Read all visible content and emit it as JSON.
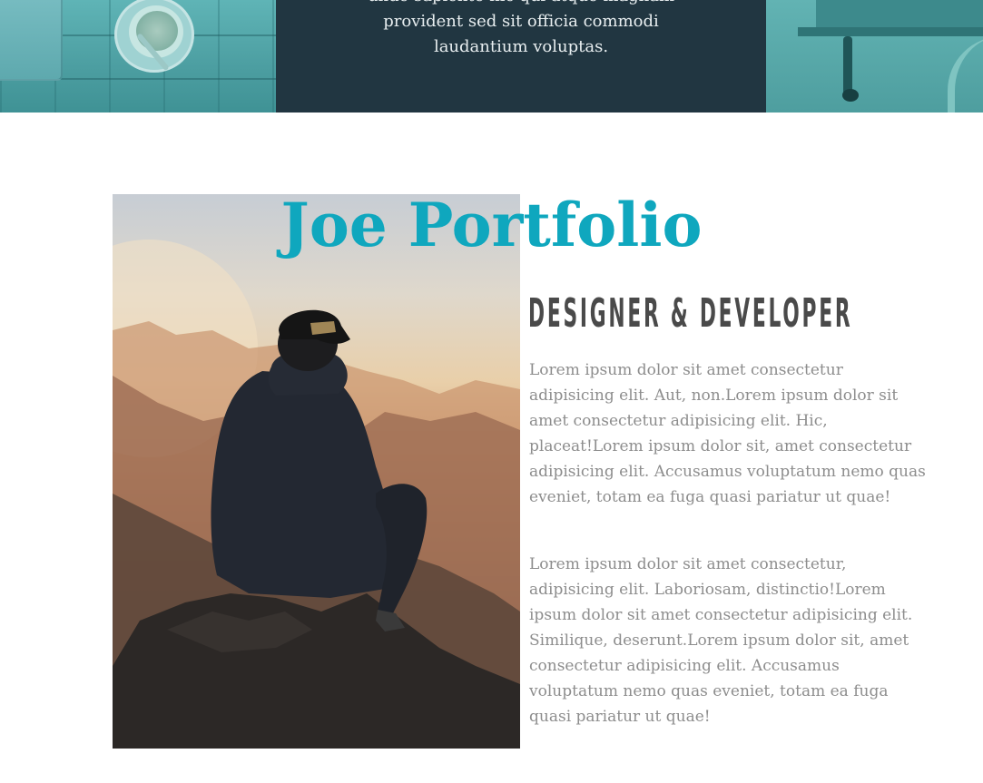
{
  "banner": {
    "quote_lines": [
      "unde sapiente hic qui atque magnam",
      "provident sed sit officia commodi",
      "laudantium voluptas."
    ]
  },
  "about": {
    "title": "Joe Portfolio",
    "subtitle": "DESIGNER & DEVELOPER",
    "paragraphs": [
      "Lorem ipsum dolor sit amet consectetur adipisicing elit. Aut, non.Lorem ipsum dolor sit amet consectetur adipisicing elit. Hic, placeat!Lorem ipsum dolor sit, amet consectetur adipisicing elit. Accusamus voluptatum nemo quas eveniet, totam ea fuga quasi pariatur ut quae!",
      "Lorem ipsum dolor sit amet consectetur, adipisicing elit. Laboriosam, distinctio!Lorem ipsum dolor sit amet consectetur adipisicing elit. Similique, deserunt.Lorem ipsum dolor sit, amet consectetur adipisicing elit. Accusamus voluptatum nemo quas eveniet, totam ea fuga quasi pariatur ut quae!"
    ],
    "photo_icon": "person-on-mountain-photo"
  },
  "colors": {
    "title": "#0fa7be",
    "banner_dark": "#213641",
    "banner_teal": "#4fa3a6",
    "body_text": "#8d8d8d",
    "subtitle": "#4a4a4a"
  }
}
